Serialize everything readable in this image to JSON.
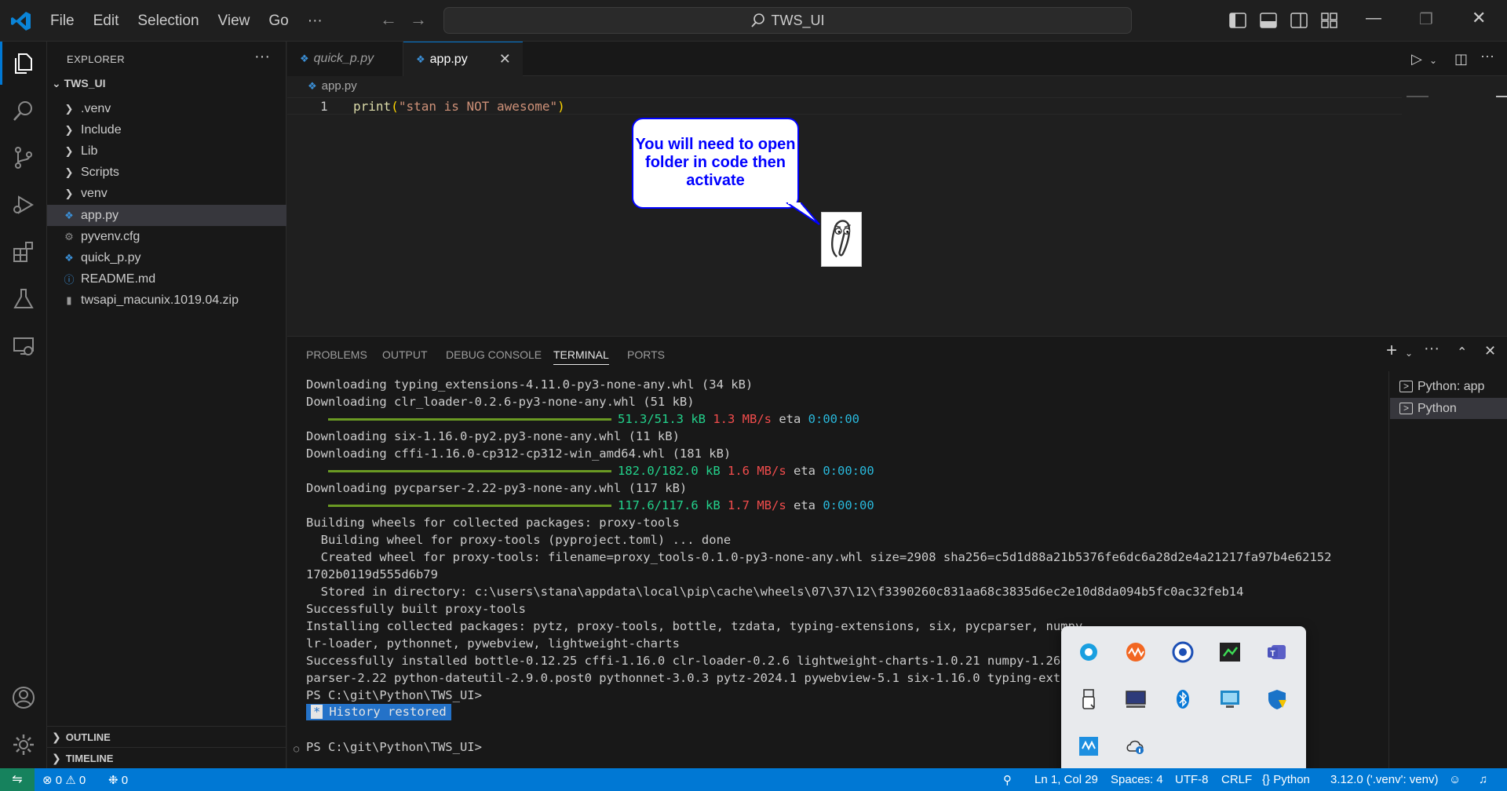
{
  "titlebar": {
    "menu": [
      "File",
      "Edit",
      "Selection",
      "View",
      "Go"
    ],
    "more": "···",
    "search_text": "TWS_UI"
  },
  "activity_bar": {
    "items": [
      "explorer-icon",
      "search-icon",
      "source-control-icon",
      "run-debug-icon",
      "extensions-icon",
      "testing-icon",
      "remote-explorer-icon"
    ],
    "bottom": [
      "accounts-icon",
      "manage-gear-icon"
    ]
  },
  "explorer": {
    "header": "EXPLORER",
    "more": "···",
    "root": "TWS_UI",
    "folders": [
      ".venv",
      "Include",
      "Lib",
      "Scripts",
      "venv"
    ],
    "files": [
      {
        "name": "app.py",
        "icon": "python-file-icon",
        "selected": true
      },
      {
        "name": "pyvenv.cfg",
        "icon": "gear-file-icon",
        "selected": false
      },
      {
        "name": "quick_p.py",
        "icon": "python-file-icon",
        "selected": false
      },
      {
        "name": "README.md",
        "icon": "info-file-icon",
        "selected": false
      },
      {
        "name": "twsapi_macunix.1019.04.zip",
        "icon": "zip-file-icon",
        "selected": false
      }
    ],
    "outline": "OUTLINE",
    "timeline": "TIMELINE"
  },
  "tabs": [
    {
      "label": "quick_p.py",
      "active": false
    },
    {
      "label": "app.py",
      "active": true
    }
  ],
  "editor": {
    "breadcrumb": "app.py",
    "line_number": "1",
    "code": {
      "fn": "print",
      "open": "(",
      "str": "\"stan is NOT awesome\"",
      "close": ")"
    }
  },
  "clippy": {
    "message": "You will need to open folder in code then activate"
  },
  "panel": {
    "tabs": [
      "PROBLEMS",
      "OUTPUT",
      "DEBUG CONSOLE",
      "TERMINAL",
      "PORTS"
    ],
    "active_tab": "TERMINAL",
    "terminals": [
      {
        "label": "Python: app",
        "selected": false
      },
      {
        "label": "Python",
        "selected": true
      }
    ]
  },
  "terminal": {
    "lines": [
      "Downloading typing_extensions-4.11.0-py3-none-any.whl (34 kB)",
      "Downloading clr_loader-0.2.6-py3-none-any.whl (51 kB)",
      "Downloading six-1.16.0-py2.py3-none-any.whl (11 kB)",
      "Downloading cffi-1.16.0-cp312-cp312-win_amd64.whl (181 kB)",
      "Downloading pycparser-2.22-py3-none-any.whl (117 kB)",
      "Building wheels for collected packages: proxy-tools",
      "  Building wheel for proxy-tools (pyproject.toml) ... done",
      "  Created wheel for proxy-tools: filename=proxy_tools-0.1.0-py3-none-any.whl size=2908 sha256=c5d1d88a21b5376fe6dc6a28d2e4a21217fa97b4e62152",
      "1702b0119d555d6b79",
      "  Stored in directory: c:\\users\\stana\\appdata\\local\\pip\\cache\\wheels\\07\\37\\12\\f3390260c831aa68c3835d6ec2e10d8da094b5fc0ac32feb14",
      "Successfully built proxy-tools",
      "Installing collected packages: pytz, proxy-tools, bottle, tzdata, typing-extensions, six, pycparser, numpy,",
      "lr-loader, pythonnet, pywebview, lightweight-charts",
      "Successfully installed bottle-0.12.25 cffi-1.16.0 clr-loader-0.2.6 lightweight-charts-1.0.21 numpy-1.26.4 p",
      "parser-2.22 python-dateutil-2.9.0.post0 pythonnet-3.0.3 pytz-2024.1 pywebview-5.1 six-1.16.0 typing-extensi",
      "PS C:\\git\\Python\\TWS_UI>",
      "PS C:\\git\\Python\\TWS_UI>"
    ],
    "progress": [
      {
        "done": "51.3/51.3 kB",
        "speed": "1.3 MB/s",
        "eta_label": "eta",
        "eta": "0:00:00",
        "fraction": 1.0
      },
      {
        "done": "182.0/182.0 kB",
        "speed": "1.6 MB/s",
        "eta_label": "eta",
        "eta": "0:00:00",
        "fraction": 1.0
      },
      {
        "done": "117.6/117.6 kB",
        "speed": "1.7 MB/s",
        "eta_label": "eta",
        "eta": "0:00:00",
        "fraction": 1.0
      }
    ],
    "history": {
      "star": "*",
      "text": "History restored"
    }
  },
  "tray": {
    "icons": [
      "app-circle-icon",
      "waves-app-icon",
      "browser-app-icon",
      "terminal-app-icon",
      "teams-icon",
      "usb-drive-icon",
      "display-icon",
      "bluetooth-icon",
      "monitor-app-icon",
      "security-shield-icon",
      "audio-app-icon",
      "cloud-sync-icon"
    ]
  },
  "statusbar": {
    "errors": "0",
    "warnings": "0",
    "ports": "0",
    "position": "Ln 1, Col 29",
    "spaces": "Spaces: 4",
    "encoding": "UTF-8",
    "eol": "CRLF",
    "language": "Python",
    "interpreter": "3.12.0 ('.venv': venv)"
  },
  "colors": {
    "accent": "#0078d4",
    "remote": "#16825d",
    "terminal_green": "#23d18b",
    "terminal_red": "#f14c4c",
    "terminal_cyan": "#29b8db",
    "clippy_text": "#0000ff"
  }
}
